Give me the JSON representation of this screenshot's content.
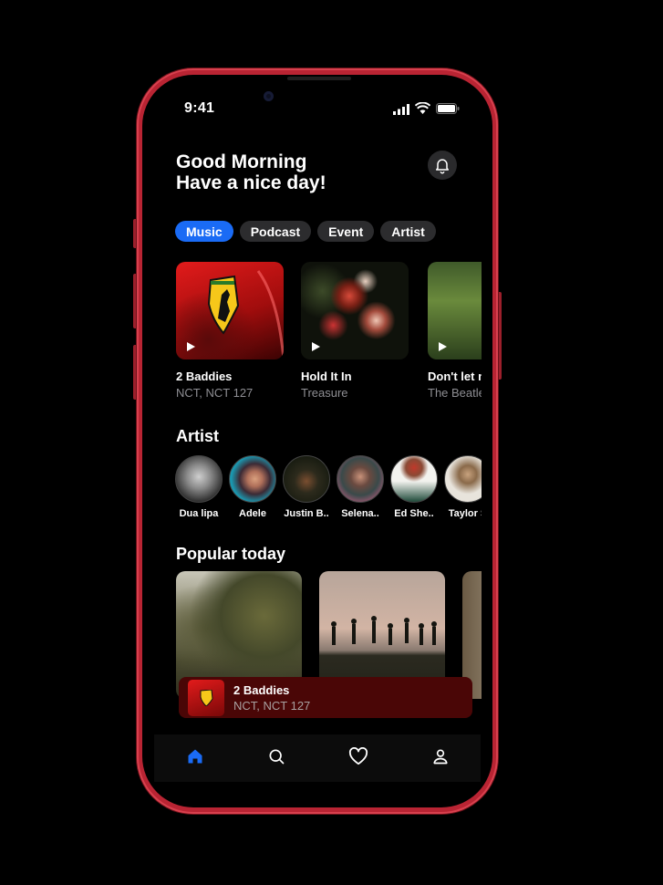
{
  "status": {
    "time": "9:41"
  },
  "header": {
    "line1": "Good Morning",
    "line2": "Have a nice day!",
    "bell_icon": "bell-icon"
  },
  "tabs": [
    {
      "label": "Music",
      "active": true
    },
    {
      "label": "Podcast",
      "active": false
    },
    {
      "label": "Event",
      "active": false
    },
    {
      "label": "Artist",
      "active": false
    }
  ],
  "songs": [
    {
      "title": "2 Baddies",
      "artist": "NCT, NCT 127"
    },
    {
      "title": "Hold It In",
      "artist": "Treasure"
    },
    {
      "title": "Don't let me",
      "artist": "The Beatles"
    }
  ],
  "artist_section": {
    "title": "Artist"
  },
  "artists": [
    "Dua lipa",
    "Adele",
    "Justin B..",
    "Selena..",
    "Ed She..",
    "Taylor S"
  ],
  "popular": {
    "title": "Popular today"
  },
  "now_playing": {
    "title": "2 Baddies",
    "artist": "NCT, NCT 127"
  },
  "nav": {
    "items": [
      "home-icon",
      "search-icon",
      "heart-icon",
      "profile-icon"
    ],
    "active": "home-icon"
  },
  "colors": {
    "accent": "#1a6bf5",
    "frame": "#b92433",
    "mini_player": "#4a0606"
  }
}
